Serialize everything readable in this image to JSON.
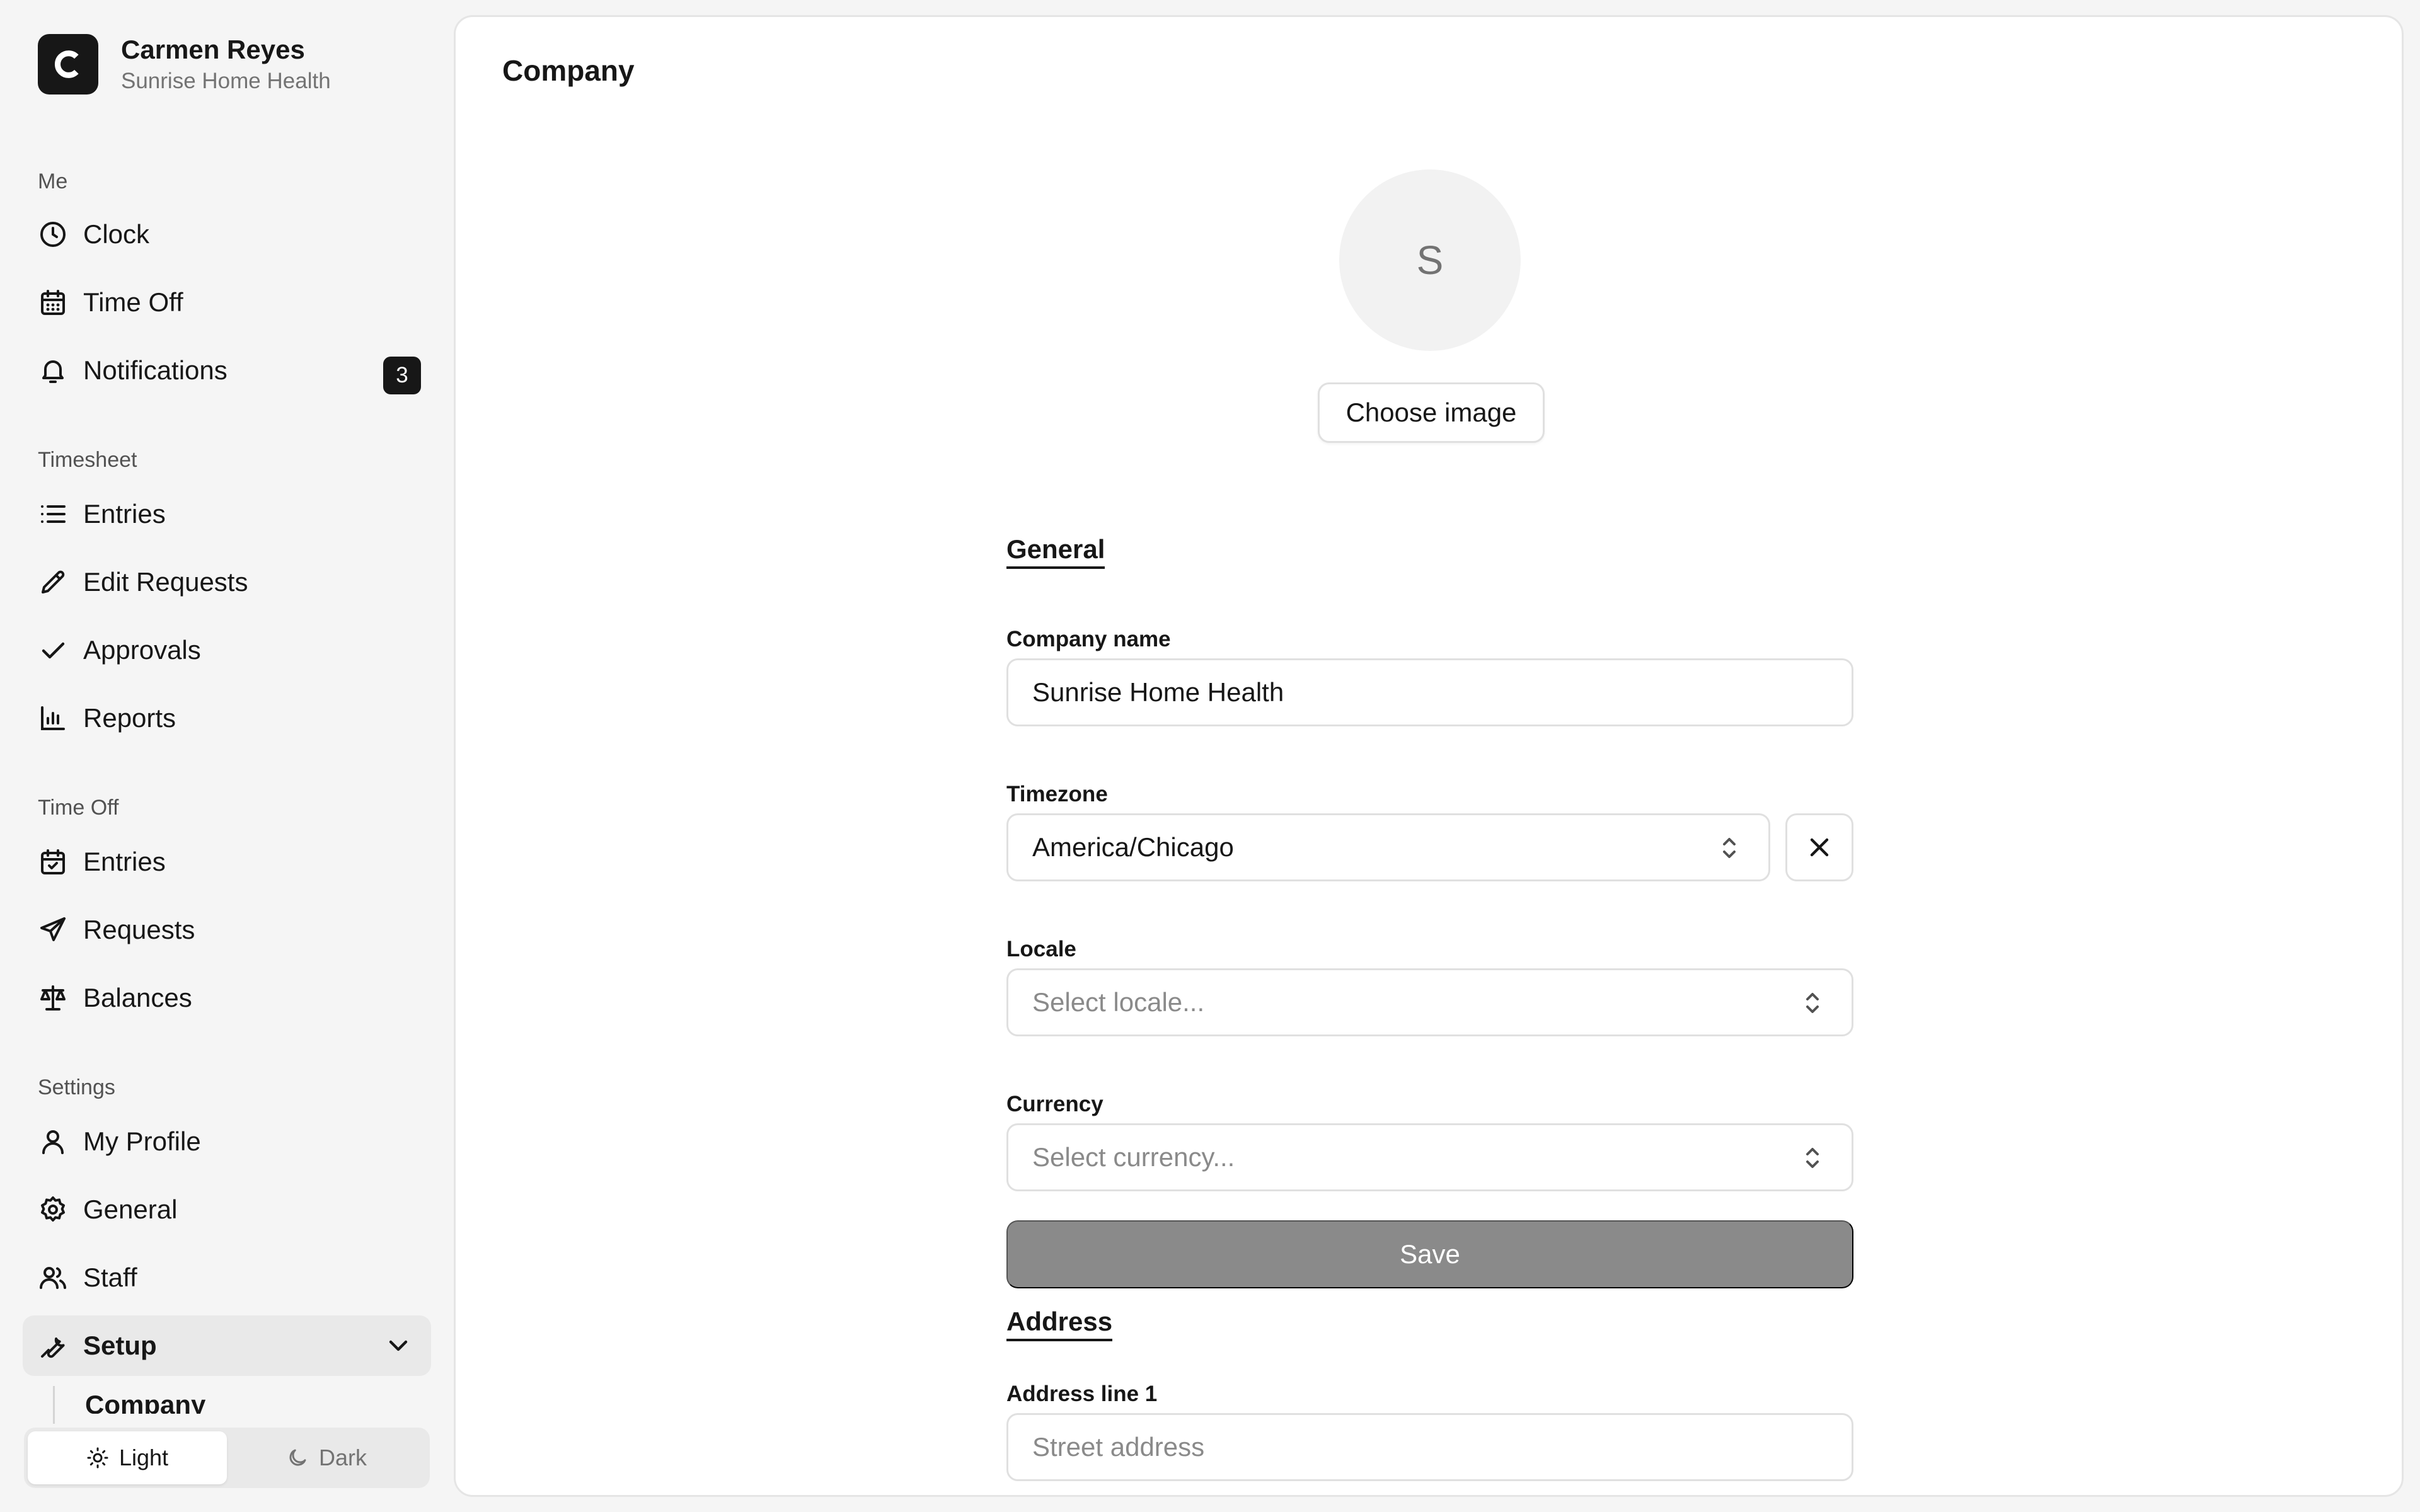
{
  "user": {
    "name": "Carmen Reyes",
    "organization": "Sunrise Home Health",
    "logo_letter": "C"
  },
  "sidebar": {
    "me": {
      "label": "Me",
      "items": [
        {
          "label": "Clock",
          "icon": "clock-icon"
        },
        {
          "label": "Time Off",
          "icon": "calendar-icon"
        },
        {
          "label": "Notifications",
          "icon": "bell-icon",
          "badge": "3"
        }
      ]
    },
    "timesheet": {
      "label": "Timesheet",
      "items": [
        {
          "label": "Entries",
          "icon": "list-icon"
        },
        {
          "label": "Edit Requests",
          "icon": "pencil-icon"
        },
        {
          "label": "Approvals",
          "icon": "check-icon"
        },
        {
          "label": "Reports",
          "icon": "bar-chart-icon"
        }
      ]
    },
    "time_off": {
      "label": "Time Off",
      "items": [
        {
          "label": "Entries",
          "icon": "calendar-check-icon"
        },
        {
          "label": "Requests",
          "icon": "send-icon"
        },
        {
          "label": "Balances",
          "icon": "scale-icon"
        }
      ]
    },
    "settings": {
      "label": "Settings",
      "items": [
        {
          "label": "My Profile",
          "icon": "user-icon"
        },
        {
          "label": "General",
          "icon": "gear-icon"
        },
        {
          "label": "Staff",
          "icon": "users-icon"
        },
        {
          "label": "Setup",
          "icon": "wrench-icon",
          "expanded": true
        }
      ],
      "setup_children": [
        {
          "label": "Company"
        }
      ]
    },
    "theme": {
      "light_label": "Light",
      "dark_label": "Dark",
      "selected": "Light"
    }
  },
  "page": {
    "title": "Company",
    "avatar_letter": "S",
    "choose_image_label": "Choose image"
  },
  "form": {
    "general_heading": "General",
    "company_name": {
      "label": "Company name",
      "value": "Sunrise Home Health"
    },
    "timezone": {
      "label": "Timezone",
      "value": "America/Chicago"
    },
    "locale": {
      "label": "Locale",
      "placeholder": "Select locale..."
    },
    "currency": {
      "label": "Currency",
      "placeholder": "Select currency..."
    },
    "save_label": "Save",
    "address_heading": "Address",
    "address_line1": {
      "label": "Address line 1",
      "placeholder": "Street address"
    }
  },
  "colors": {
    "accent": "#171717",
    "muted": "#737373",
    "disabled_button": "#8a8a8a",
    "border": "#e0e0e0"
  }
}
